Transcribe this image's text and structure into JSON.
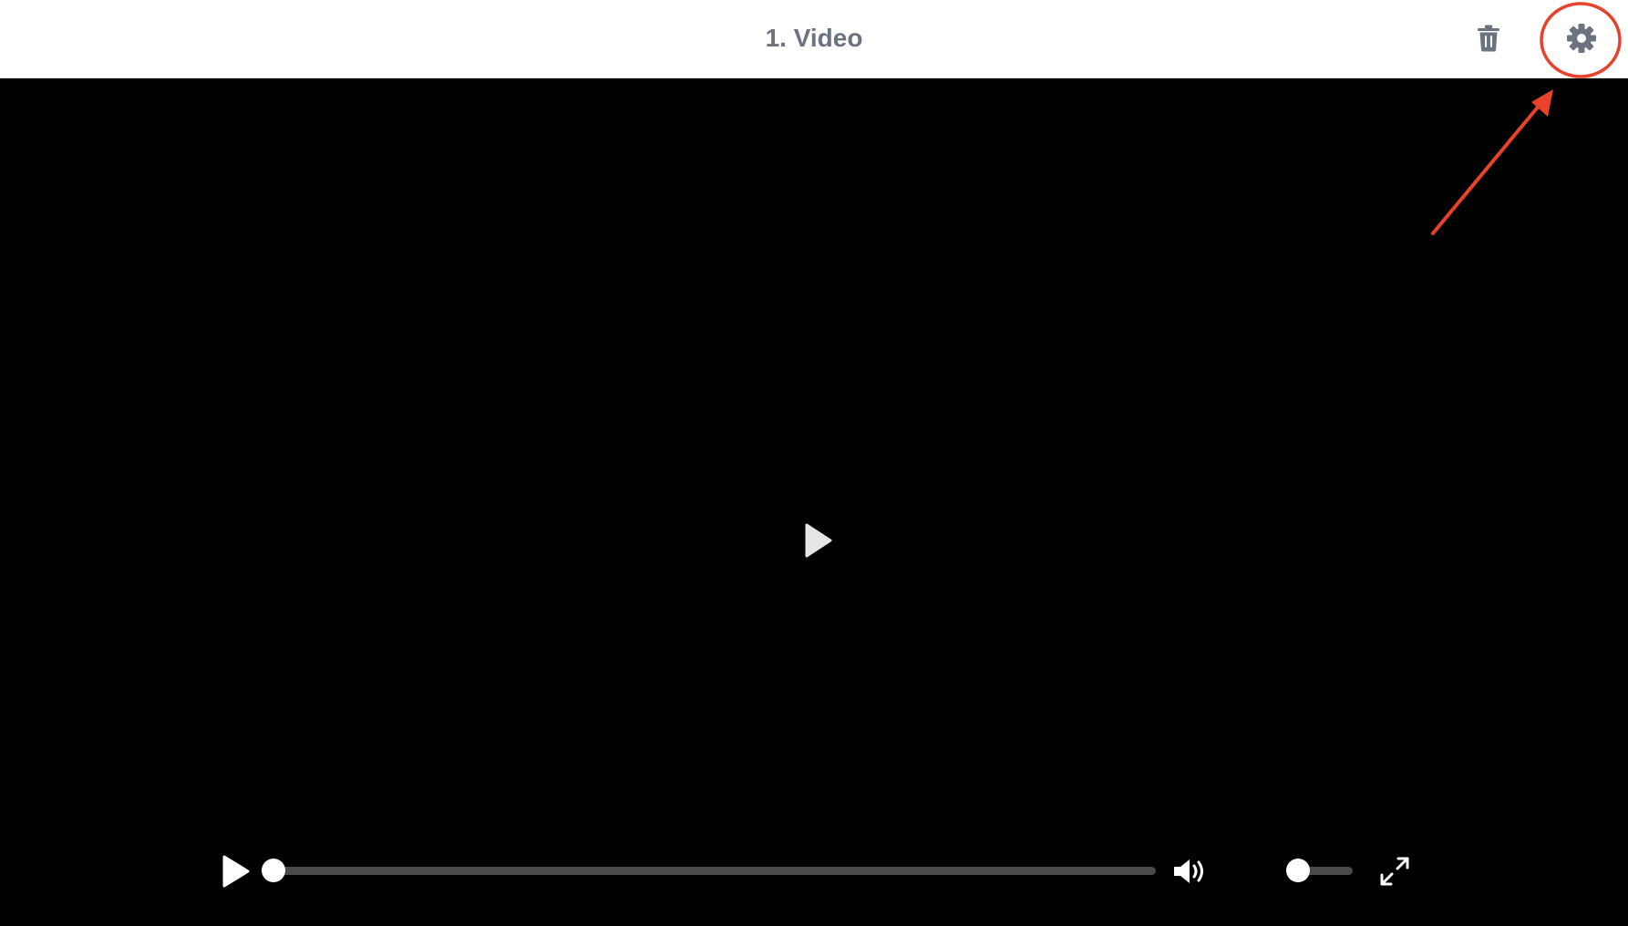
{
  "header": {
    "title": "1. Video",
    "icons": {
      "delete": "trash-icon",
      "settings": "gear-icon"
    }
  },
  "player": {
    "center_icon": "play-icon",
    "controls": {
      "play_icon": "play-icon",
      "progress_fraction": 0.0,
      "volume_icon": "volume-high-icon",
      "volume_fraction": 0.0,
      "fullscreen_icon": "expand-icon"
    }
  },
  "annotation": {
    "target": "settings-button",
    "color": "#e8412c"
  },
  "colors": {
    "header_text": "#6b7280",
    "player_bg": "#000000",
    "track": "#4a4a4a",
    "annotation": "#e8412c"
  }
}
